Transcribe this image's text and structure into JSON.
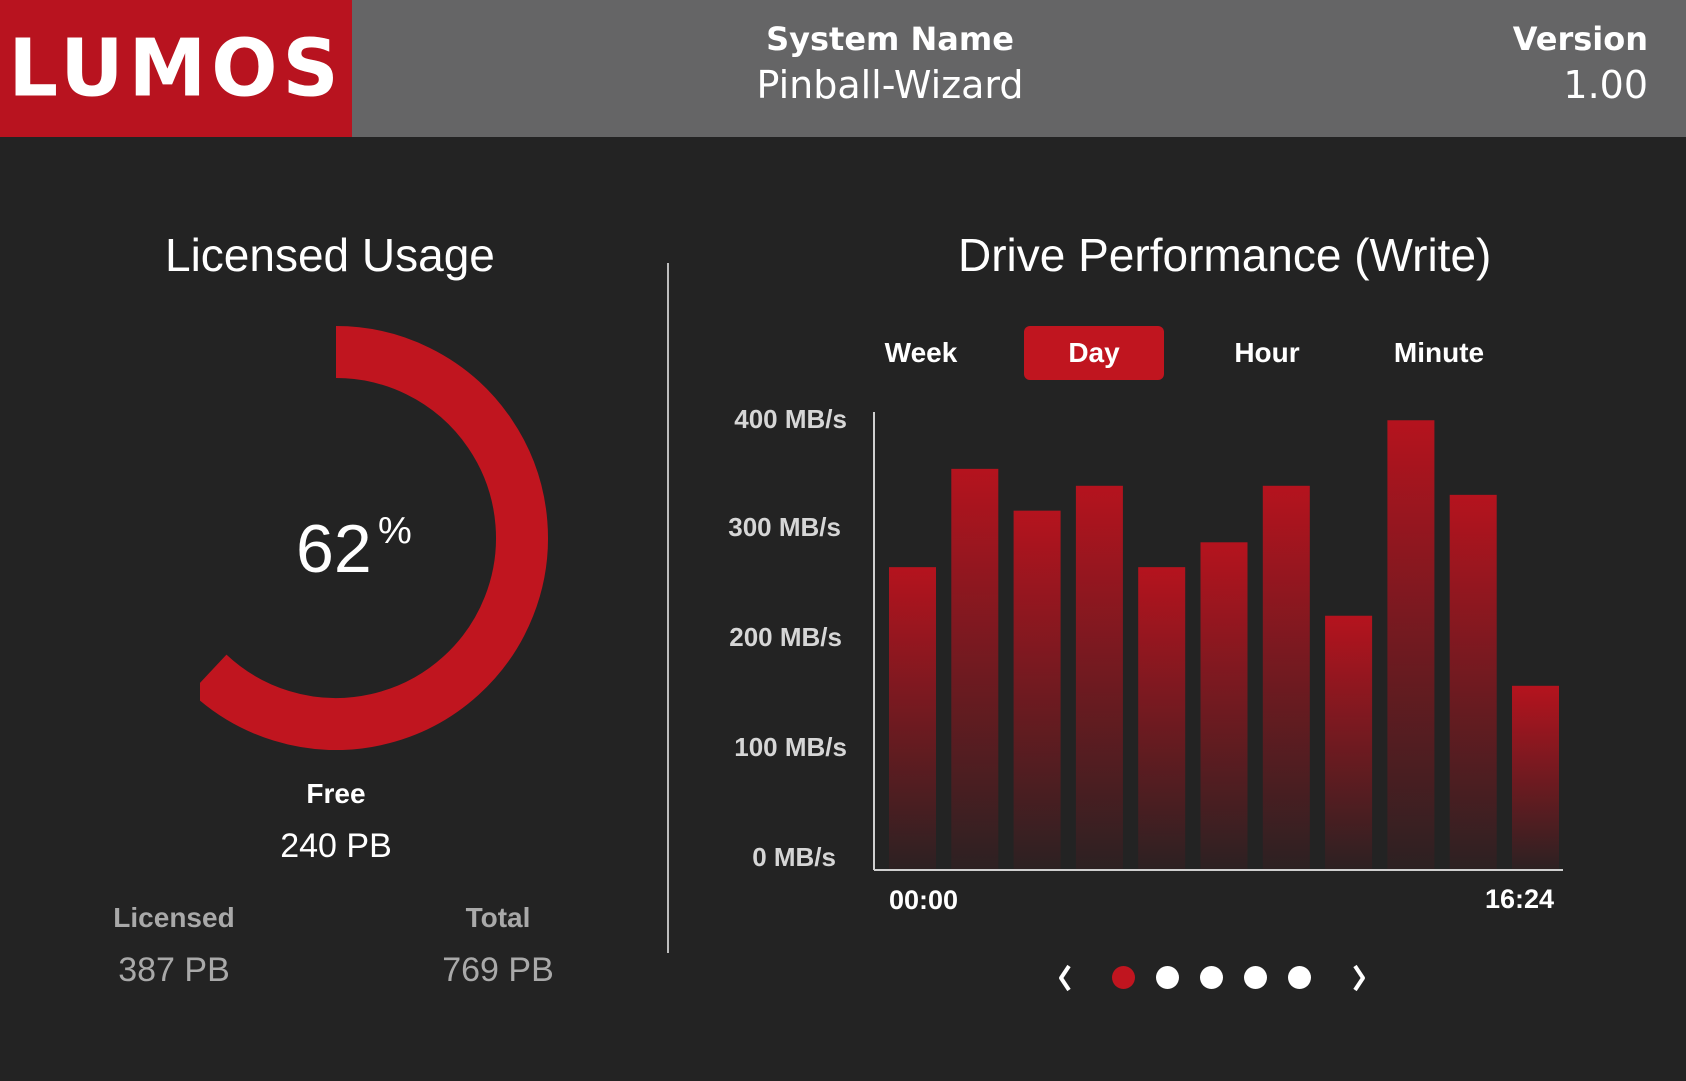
{
  "header": {
    "logo_text": "LUMOS",
    "system_name_label": "System Name",
    "system_name_value": "Pinball-Wizard",
    "version_label": "Version",
    "version_value": "1.00"
  },
  "usage": {
    "title": "Licensed Usage",
    "percent_value": "62",
    "percent_sign": "%",
    "used_fraction": 0.62,
    "free_label": "Free",
    "free_value": "240 PB",
    "licensed_label": "Licensed",
    "licensed_value": "387 PB",
    "total_label": "Total",
    "total_value": "769 PB",
    "arc_color": "#c0151f"
  },
  "performance": {
    "title": "Drive Performance (Write)",
    "tabs": [
      {
        "label": "Week",
        "active": false
      },
      {
        "label": "Day",
        "active": true
      },
      {
        "label": "Hour",
        "active": false
      },
      {
        "label": "Minute",
        "active": false
      }
    ],
    "pager": {
      "count": 5,
      "active_index": 0
    }
  },
  "chart_data": {
    "type": "bar",
    "title": "Drive Performance (Write)",
    "y_ticks": [
      "400 MB/s",
      "300 MB/s",
      "200 MB/s",
      "100 MB/s",
      "0 MB/s"
    ],
    "x_tick_labels": [
      "00:00",
      "16:24"
    ],
    "ylim": [
      0,
      400
    ],
    "values": [
      268,
      355,
      318,
      340,
      268,
      290,
      340,
      225,
      398,
      332,
      163
    ],
    "bar_color_top": "#b5131e",
    "bar_color_bottom": "#2c2122",
    "grid": false
  }
}
